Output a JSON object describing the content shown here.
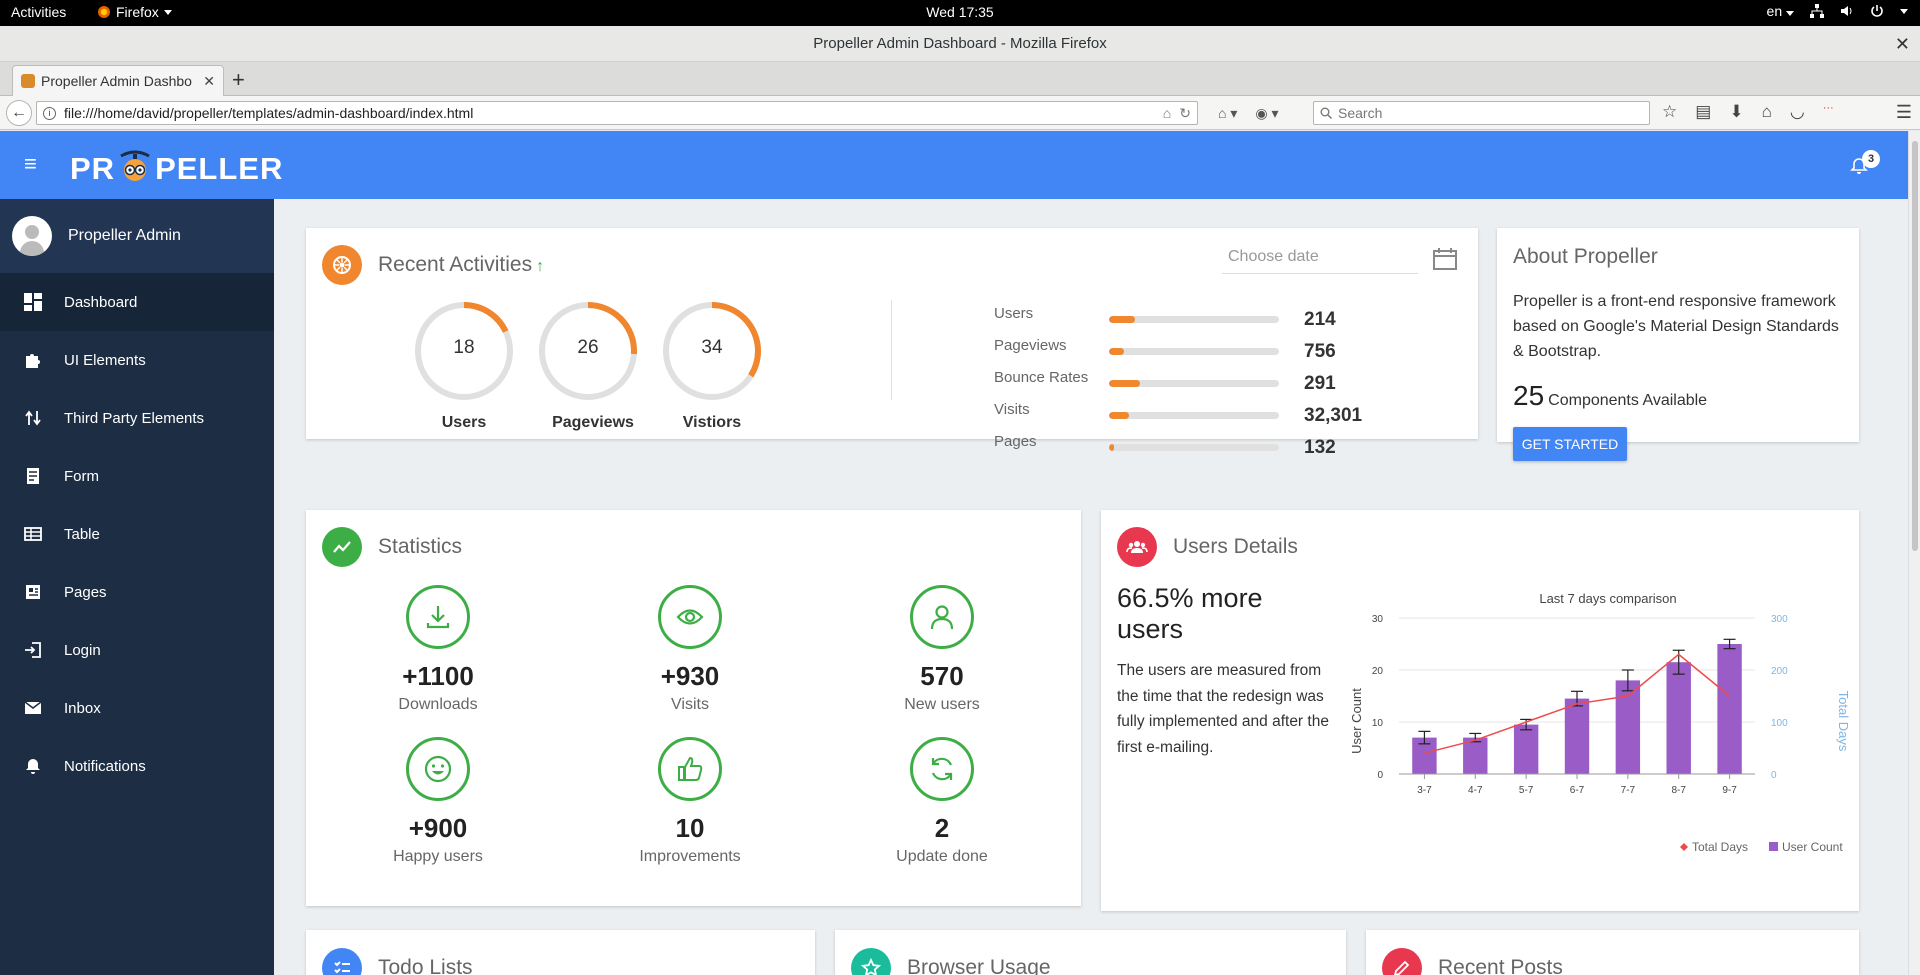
{
  "os": {
    "activities": "Activities",
    "app_menu": "Firefox",
    "clock": "Wed 17:35",
    "lang": "en"
  },
  "browser": {
    "window_title": "Propeller Admin Dashboard - Mozilla Firefox",
    "tab_title": "Propeller Admin Dashbo",
    "url": "file:///home/david/propeller/templates/admin-dashboard/index.html",
    "search_placeholder": "Search"
  },
  "header": {
    "logo_left": "PR",
    "logo_right": "PELLER",
    "notification_count": "3"
  },
  "sidebar": {
    "user_name": "Propeller Admin",
    "items": [
      {
        "label": "Dashboard",
        "icon": "dashboard-icon"
      },
      {
        "label": "UI Elements",
        "icon": "puzzle-icon"
      },
      {
        "label": "Third Party Elements",
        "icon": "swap-icon"
      },
      {
        "label": "Form",
        "icon": "form-icon"
      },
      {
        "label": "Table",
        "icon": "table-icon"
      },
      {
        "label": "Pages",
        "icon": "pages-icon"
      },
      {
        "label": "Login",
        "icon": "login-icon"
      },
      {
        "label": "Inbox",
        "icon": "mail-icon"
      },
      {
        "label": "Notifications",
        "icon": "bell-icon"
      }
    ]
  },
  "recent": {
    "title": "Recent Activities",
    "date_placeholder": "Choose date",
    "rings": [
      {
        "value": "18",
        "label": "Users",
        "fraction": 0.18
      },
      {
        "value": "26",
        "label": "Pageviews",
        "fraction": 0.26
      },
      {
        "value": "34",
        "label": "Vistiors",
        "fraction": 0.34
      }
    ],
    "bars": [
      {
        "label": "Users",
        "value": "214",
        "fraction": 0.15
      },
      {
        "label": "Pageviews",
        "value": "756",
        "fraction": 0.09
      },
      {
        "label": "Bounce Rates",
        "value": "291",
        "fraction": 0.18
      },
      {
        "label": "Visits",
        "value": "32,301",
        "fraction": 0.12
      },
      {
        "label": "Pages",
        "value": "132",
        "fraction": 0.03
      }
    ]
  },
  "about": {
    "title": "About Propeller",
    "text": "Propeller is a front-end responsive framework based on Google's Material Design Standards & Bootstrap.",
    "count": "25",
    "count_label": "Components Available",
    "button": "Get Started"
  },
  "statistics": {
    "title": "Statistics",
    "items": [
      {
        "value": "+1100",
        "label": "Downloads",
        "icon": "download-icon"
      },
      {
        "value": "+930",
        "label": "Visits",
        "icon": "eye-icon"
      },
      {
        "value": "570",
        "label": "New users",
        "icon": "user-icon"
      },
      {
        "value": "+900",
        "label": "Happy users",
        "icon": "smile-icon"
      },
      {
        "value": "10",
        "label": "Improvements",
        "icon": "thumbs-up-icon"
      },
      {
        "value": "2",
        "label": "Update done",
        "icon": "refresh-icon"
      }
    ]
  },
  "users_details": {
    "title": "Users Details",
    "headline": "66.5% more users",
    "text": "The users are measured from the time that the redesign was fully implemented and after the first e-mailing."
  },
  "chart_data": {
    "type": "bar",
    "title": "Last 7 days comparison",
    "categories": [
      "3-7",
      "4-7",
      "5-7",
      "6-7",
      "7-7",
      "8-7",
      "9-7"
    ],
    "series": [
      {
        "name": "User Count",
        "type": "bar",
        "axis": "left",
        "values": [
          7,
          7,
          9.5,
          14.5,
          18,
          21.5,
          25
        ],
        "errors": [
          1.2,
          0.8,
          1,
          1.4,
          2,
          2.3,
          0.9
        ],
        "color": "#9a5cc6"
      },
      {
        "name": "Total Days",
        "type": "line",
        "axis": "right",
        "values": [
          40,
          65,
          100,
          135,
          150,
          230,
          150
        ],
        "color": "#ef4b4b"
      }
    ],
    "ylabel": "User Count",
    "y2label": "Total Days",
    "ylim": [
      0,
      30
    ],
    "y2lim": [
      0,
      300
    ],
    "yticks": [
      "0",
      "10",
      "20",
      "30"
    ],
    "y2ticks": [
      "0",
      "100",
      "200",
      "300"
    ],
    "legend": "bottom-right"
  },
  "bottom_cards": {
    "todo": "Todo Lists",
    "browser": "Browser Usage",
    "posts": "Recent Posts"
  },
  "colors": {
    "primary": "#4285f4",
    "sidebar": "#1d2d44",
    "orange": "#f0872f",
    "green": "#3dae45",
    "red": "#e8384f",
    "teal": "#1abc9c",
    "purple": "#9a5cc6"
  }
}
